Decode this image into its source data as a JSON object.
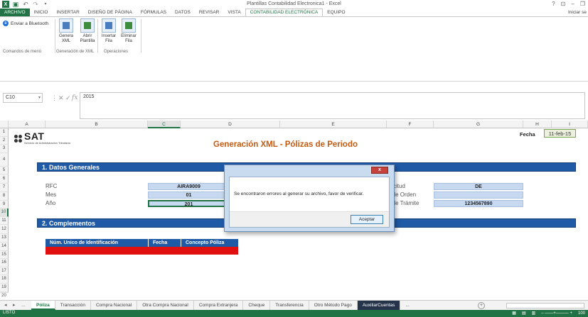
{
  "window": {
    "title": "Plantillas Contabilidad Electronica1 - Excel",
    "controls": [
      "?",
      "⊡",
      "–",
      "❐"
    ]
  },
  "ribbon_tabs": [
    "ARCHIVO",
    "INICIO",
    "INSERTAR",
    "DISEÑO DE PÁGINA",
    "FÓRMULAS",
    "DATOS",
    "REVISAR",
    "VISTA",
    "CONTABILIDAD ELECTRÓNICA",
    "EQUIPO"
  ],
  "signin": "Iniciar se",
  "ribbon": {
    "bluetooth": "Enviar a Bluetooth",
    "group_menu": "Comandos de menú",
    "buttons": [
      {
        "line1": "Genera",
        "line2": "XML"
      },
      {
        "line1": "Abrir",
        "line2": "Plantilla"
      },
      {
        "line1": "Insertar",
        "line2": "Fila"
      },
      {
        "line1": "Eliminar",
        "line2": "Fila"
      }
    ],
    "group_xml": "Generación de XML",
    "group_ops": "Operaciones"
  },
  "formula_bar": {
    "name_box": "C10",
    "fx": "fx",
    "value": "2015"
  },
  "columns": [
    "A",
    "B",
    "C",
    "D",
    "E",
    "F",
    "G",
    "H",
    "I"
  ],
  "rows": [
    "1",
    "2",
    "3",
    "4",
    "5",
    "6",
    "7",
    "8",
    "9",
    "10",
    "11",
    "12",
    "13",
    "14",
    "15",
    "16",
    "17",
    "18",
    "19",
    "20"
  ],
  "sheet": {
    "logo_text": "SAT",
    "logo_sub": "Servicio de Administración Tributaria",
    "title": "Generación XML - Pólizas de Periodo",
    "fecha_label": "Fecha",
    "fecha_value": "11-feb-15",
    "section1": "1. Datos Generales",
    "section2": "2. Complementos",
    "fields": [
      {
        "label": "RFC",
        "value": "AIRA9009"
      },
      {
        "label": "Mes",
        "value": "01"
      },
      {
        "label": "Año",
        "value": "201"
      }
    ],
    "right_fields": [
      {
        "label": "olicitud",
        "value": "DE"
      },
      {
        "label": "o de Orden",
        "value": ""
      },
      {
        "label": "o de Trámite",
        "value": "1234567890"
      }
    ],
    "table_headers": [
      "Núm. Unico de Identificación",
      "Fecha",
      "Concepto Póliza"
    ]
  },
  "dialog": {
    "close": "x",
    "message": "Se encontraron errores al generar su archivo, favor de verificar.",
    "button": "Aceptar"
  },
  "sheet_tabs": [
    "Póliza",
    "Transacción",
    "Compra Nacional",
    "Otra Compra Nacional",
    "Compra Extranjera",
    "Cheque",
    "Transferencia",
    "Otro Método Pago",
    "AuxiliarCuentas",
    "..."
  ],
  "nav": {
    "left": "◂",
    "right": "▸",
    "more": "..."
  },
  "status": {
    "text": "LISTO",
    "zoom": "100"
  },
  "colors": {
    "excel_green": "#217346",
    "section_blue": "#1f5aa6",
    "title_orange": "#c55a11",
    "error_red": "#e01010"
  }
}
